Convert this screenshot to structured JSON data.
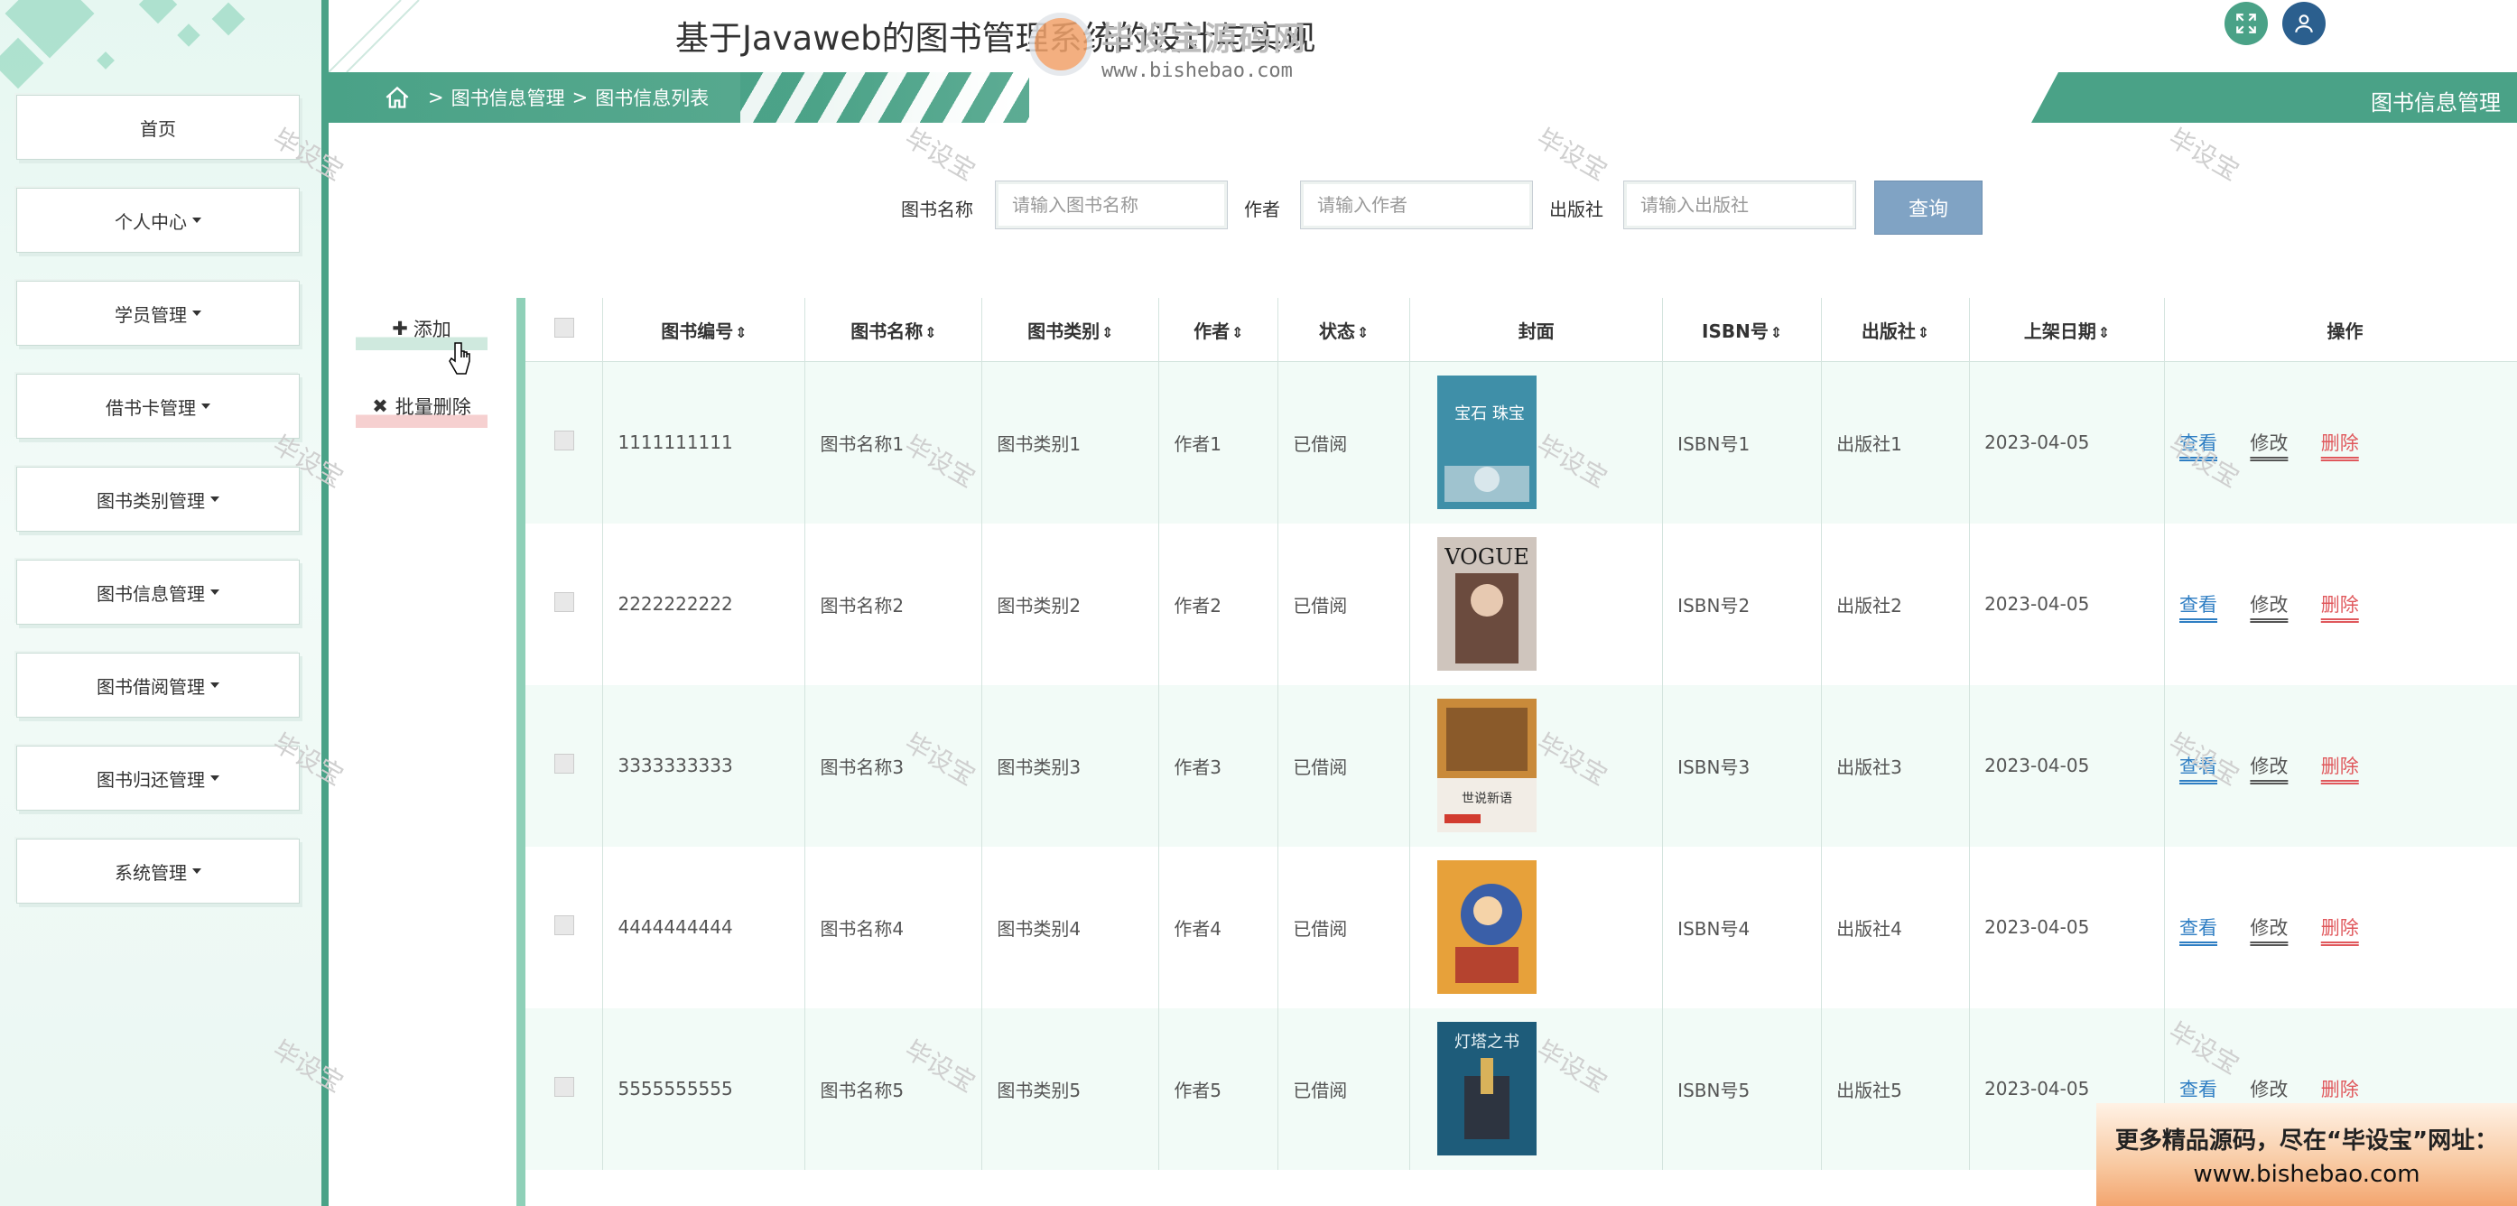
{
  "app_title": "基于Javaweb的图书管理系统的设计与实现",
  "watermark": {
    "site_name": "毕设宝源码网",
    "site_url": "www.bishebao.com",
    "stamp": "毕设宝"
  },
  "header": {
    "section_title": "图书信息管理"
  },
  "breadcrumb": {
    "level1": "图书信息管理",
    "level2": "图书信息列表",
    "separator": ">"
  },
  "sidebar": {
    "items": [
      {
        "label": "首页"
      },
      {
        "label": "个人中心"
      },
      {
        "label": "学员管理"
      },
      {
        "label": "借书卡管理"
      },
      {
        "label": "图书类别管理"
      },
      {
        "label": "图书信息管理"
      },
      {
        "label": "图书借阅管理"
      },
      {
        "label": "图书归还管理"
      },
      {
        "label": "系统管理"
      }
    ]
  },
  "search": {
    "name_label": "图书名称",
    "name_placeholder": "请输入图书名称",
    "author_label": "作者",
    "author_placeholder": "请输入作者",
    "publisher_label": "出版社",
    "publisher_placeholder": "请输入出版社",
    "query_button": "查询"
  },
  "actions": {
    "add": "添加",
    "batch_delete": "批量删除"
  },
  "table": {
    "columns": [
      "图书编号",
      "图书名称",
      "图书类别",
      "作者",
      "状态",
      "封面",
      "ISBN号",
      "出版社",
      "上架日期",
      "操作"
    ],
    "row_actions": {
      "view": "查看",
      "edit": "修改",
      "delete": "删除"
    },
    "rows": [
      {
        "id": "1111111111",
        "name": "图书名称1",
        "category": "图书类别1",
        "author": "作者1",
        "status": "已借阅",
        "isbn": "ISBN号1",
        "publisher": "出版社1",
        "date": "2023-04-05",
        "cover_text": "宝石 珠宝"
      },
      {
        "id": "2222222222",
        "name": "图书名称2",
        "category": "图书类别2",
        "author": "作者2",
        "status": "已借阅",
        "isbn": "ISBN号2",
        "publisher": "出版社2",
        "date": "2023-04-05",
        "cover_text": "VOGUE"
      },
      {
        "id": "3333333333",
        "name": "图书名称3",
        "category": "图书类别3",
        "author": "作者3",
        "status": "已借阅",
        "isbn": "ISBN号3",
        "publisher": "出版社3",
        "date": "2023-04-05",
        "cover_text": "世说新语"
      },
      {
        "id": "4444444444",
        "name": "图书名称4",
        "category": "图书类别4",
        "author": "作者4",
        "status": "已借阅",
        "isbn": "ISBN号4",
        "publisher": "出版社4",
        "date": "2023-04-05",
        "cover_text": ""
      },
      {
        "id": "5555555555",
        "name": "图书名称5",
        "category": "图书类别5",
        "author": "作者5",
        "status": "已借阅",
        "isbn": "ISBN号5",
        "publisher": "出版社5",
        "date": "2023-04-05",
        "cover_text": "灯塔之书"
      }
    ]
  },
  "banner": {
    "line1": "更多精品源码，尽在“毕设宝”网址：",
    "line2": "www.bishebao.com"
  },
  "colors": {
    "primary": "#4aa287",
    "query": "#80a3c4",
    "link_view": "#2f7ec3",
    "link_delete": "#e0585c"
  }
}
